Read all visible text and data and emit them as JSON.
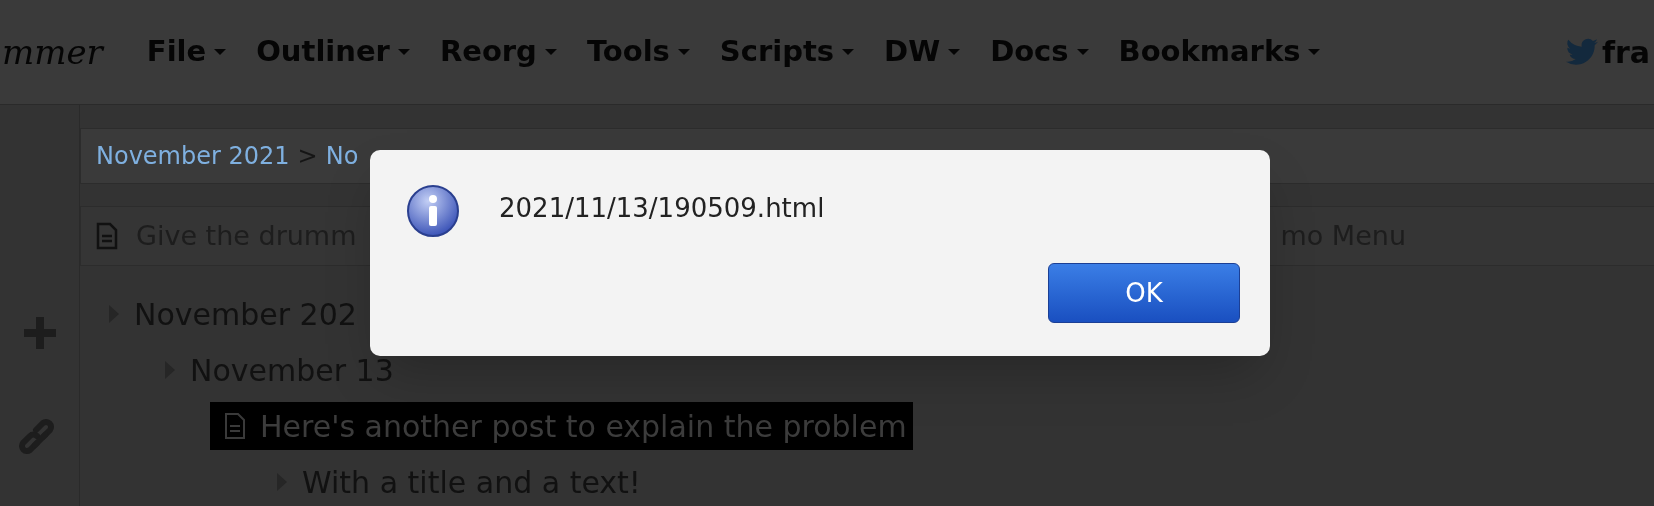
{
  "logo": "mmer",
  "menu": [
    {
      "label": "File"
    },
    {
      "label": "Outliner"
    },
    {
      "label": "Reorg"
    },
    {
      "label": "Tools"
    },
    {
      "label": "Scripts"
    },
    {
      "label": "DW"
    },
    {
      "label": "Docs"
    },
    {
      "label": "Bookmarks"
    }
  ],
  "account": "fra",
  "breadcrumb": [
    {
      "kind": "link",
      "label": "November 2021"
    },
    {
      "kind": "separator",
      "label": ">"
    },
    {
      "kind": "link",
      "label": "No"
    }
  ],
  "title_bar": {
    "left": "Give the drumm",
    "right": "mo Menu"
  },
  "outline": [
    {
      "kind": "node",
      "text": "November 202",
      "selected": false,
      "children": [
        {
          "kind": "node",
          "text": "November 13",
          "selected": false,
          "children": [
            {
              "kind": "post",
              "text": "Here's another post to explain the problem",
              "selected": true,
              "children": [
                {
                  "kind": "node",
                  "text": "With a title and a text!",
                  "selected": false
                }
              ]
            }
          ]
        }
      ]
    }
  ],
  "dialog": {
    "message": "2021/11/13/190509.html",
    "button": "OK"
  }
}
